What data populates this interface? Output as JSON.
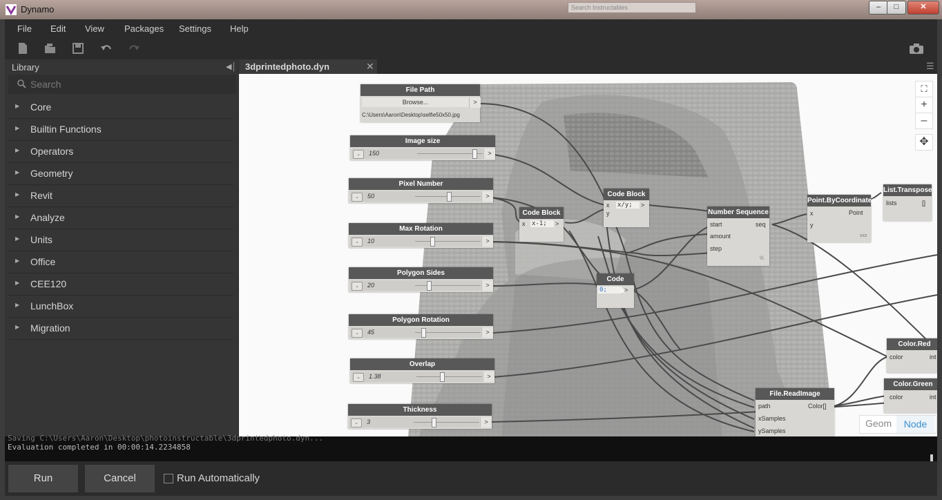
{
  "window": {
    "title": "Dynamo",
    "search_placeholder": "Search Instructables"
  },
  "menu": [
    "File",
    "Edit",
    "View",
    "Packages",
    "Settings",
    "Help"
  ],
  "library": {
    "title": "Library",
    "search_placeholder": "Search",
    "categories": [
      "Core",
      "Builtin Functions",
      "Operators",
      "Geometry",
      "Revit",
      "Analyze",
      "Units",
      "Office",
      "CEE120",
      "LunchBox",
      "Migration"
    ]
  },
  "tab": {
    "name": "3dprintedphoto.dyn"
  },
  "nodes": {
    "file_path": {
      "title": "File Path",
      "button": "Browse...",
      "out": ">",
      "value": "C:\\Users\\Aaron\\Desktop\\selfie50x50.jpg"
    },
    "image_size": {
      "title": "Image size",
      "value": "150"
    },
    "pixel_number": {
      "title": "Pixel Number",
      "value": "50"
    },
    "max_rotation": {
      "title": "Max Rotation",
      "value": "10"
    },
    "polygon_sides": {
      "title": "Polygon Sides",
      "value": "20"
    },
    "polygon_rotation": {
      "title": "Polygon Rotation",
      "value": "45"
    },
    "overlap": {
      "title": "Overlap",
      "value": "1.38"
    },
    "thickness": {
      "title": "Thickness",
      "value": "3"
    },
    "code_block_1": {
      "title": "Code Block",
      "port": "x",
      "code": "x-1;",
      "out": ">"
    },
    "code_block_2": {
      "title": "Code Block",
      "port_x": "x",
      "port_y": "y",
      "code": "x/y;",
      "out": ">"
    },
    "code_block_3": {
      "title": "Code Block",
      "code": "0;",
      "out": ">"
    },
    "number_sequence": {
      "title": "Number Sequence",
      "inputs": [
        "start",
        "amount",
        "step"
      ],
      "output": "seq",
      "lacing": "\\\\\\"
    },
    "point_by_coords": {
      "title": "Point.ByCoordinates",
      "inputs": [
        "x",
        "y"
      ],
      "output": "Point",
      "lacing": "xxx"
    },
    "list_transpose": {
      "title": "List.Transpose",
      "input": "lists",
      "output": "[]"
    },
    "color_red": {
      "title": "Color.Red",
      "input": "color",
      "output": "int"
    },
    "color_green": {
      "title": "Color.Green",
      "input": "color",
      "output": "int"
    },
    "file_read_image": {
      "title": "File.ReadImage",
      "inputs": [
        "path",
        "xSamples",
        "ySamples"
      ],
      "output": "Color[]"
    }
  },
  "view_toggle": {
    "geom": "Geom",
    "node": "Node"
  },
  "console": {
    "line1": "Saving C:\\Users\\Aaron\\Desktop\\photoinstructable\\3dprintedphoto.dyn...",
    "line2": "Evaluation completed in 00:00:14.2234858"
  },
  "bottom": {
    "run": "Run",
    "cancel": "Cancel",
    "auto": "Run Automatically"
  }
}
